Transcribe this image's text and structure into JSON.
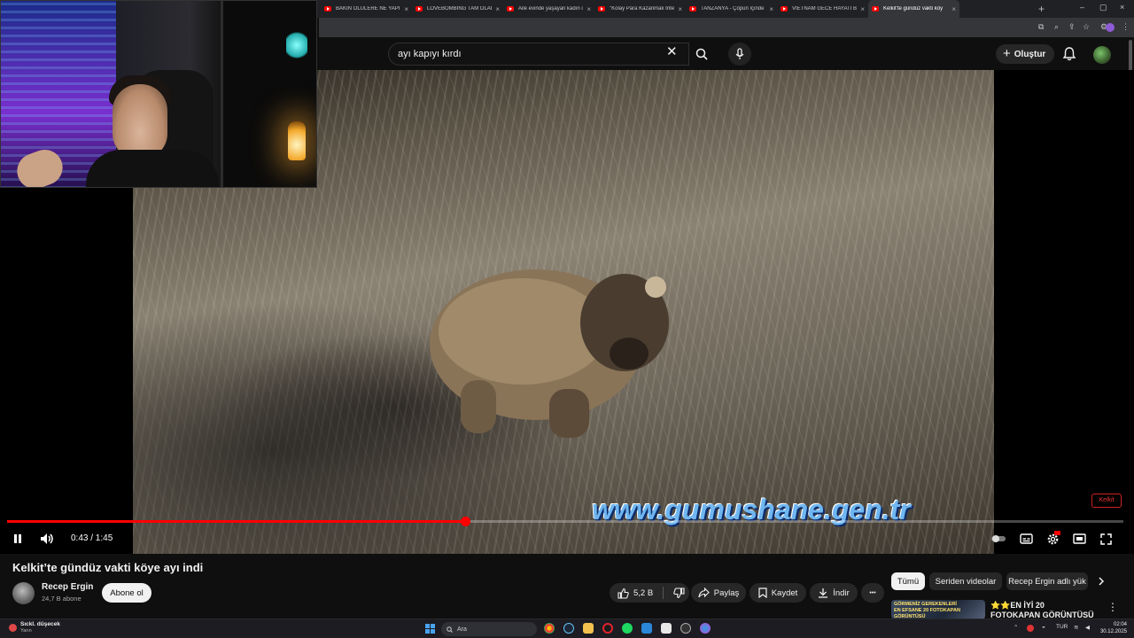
{
  "browser": {
    "tabs": [
      {
        "label": "BAKIN ÖLÜLERE NE YAPIYOR",
        "active": false
      },
      {
        "label": "LOVEBOMBING TAM OLARAK",
        "active": false
      },
      {
        "label": "Aile evinde yaşayan kadın ol",
        "active": false
      },
      {
        "label": "\"Kolay Para Kazanmak İnterk",
        "active": false
      },
      {
        "label": "TANZANYA - Çöpün İçinde Ş",
        "active": false
      },
      {
        "label": "VİETNAM GECE HAYATI BENİ",
        "active": false
      },
      {
        "label": "Kelkit'te gündüz vakti köy",
        "active": true
      }
    ],
    "tab_close_glyph": "×",
    "new_tab_glyph": "+",
    "window_controls": [
      "–",
      "▢",
      "×"
    ]
  },
  "header": {
    "search_value": "ayı kapıyı kırdı",
    "clear_glyph": "✕",
    "create_label": "Oluştur",
    "create_glyph": "+"
  },
  "video": {
    "watermark": "www.gumushane.gen.tr",
    "logo_text": "Kelkit",
    "time_current": "0:43",
    "time_total": "1:45",
    "time_display": "0:43 / 1:45",
    "progress_fraction": 0.41
  },
  "info": {
    "title": "Kelkit’te gündüz vakti köye ayı indi",
    "channel_name": "Recep Ergin",
    "subscribers": "24,7 B abone",
    "subscribe_label": "Abone ol",
    "likes": "5,2 B",
    "share_label": "Paylaş",
    "save_label": "Kaydet",
    "download_label": "İndir",
    "more_glyph": "•••"
  },
  "chips": [
    {
      "label": "Tümü",
      "selected": true
    },
    {
      "label": "Seriden videolar",
      "selected": false
    },
    {
      "label": "Recep Ergin adlı yük",
      "selected": false
    }
  ],
  "recommended": {
    "thumb_line1": "GÖRMENİZ GEREKENLERİ",
    "thumb_line2": "EN EFSANE 20 FOTOKAPAN GÖRÜNTÜSÜ",
    "title": "⭐⭐EN İYİ 20 FOTOKAPAN GÖRÜNTÜSÜ / TOP 20",
    "menu_glyph": "⋮"
  },
  "taskbar": {
    "weather_line1": "Sıckl. düşecek",
    "weather_line2": "Yarın",
    "search_placeholder": "Ara",
    "language": "TUR",
    "time": "02:04",
    "date": "30.12.2025"
  },
  "colors": {
    "youtube_red": "#ff0000",
    "background": "#0f0f0f",
    "chip_selected": "#f1f1f1",
    "pill": "#272727"
  }
}
